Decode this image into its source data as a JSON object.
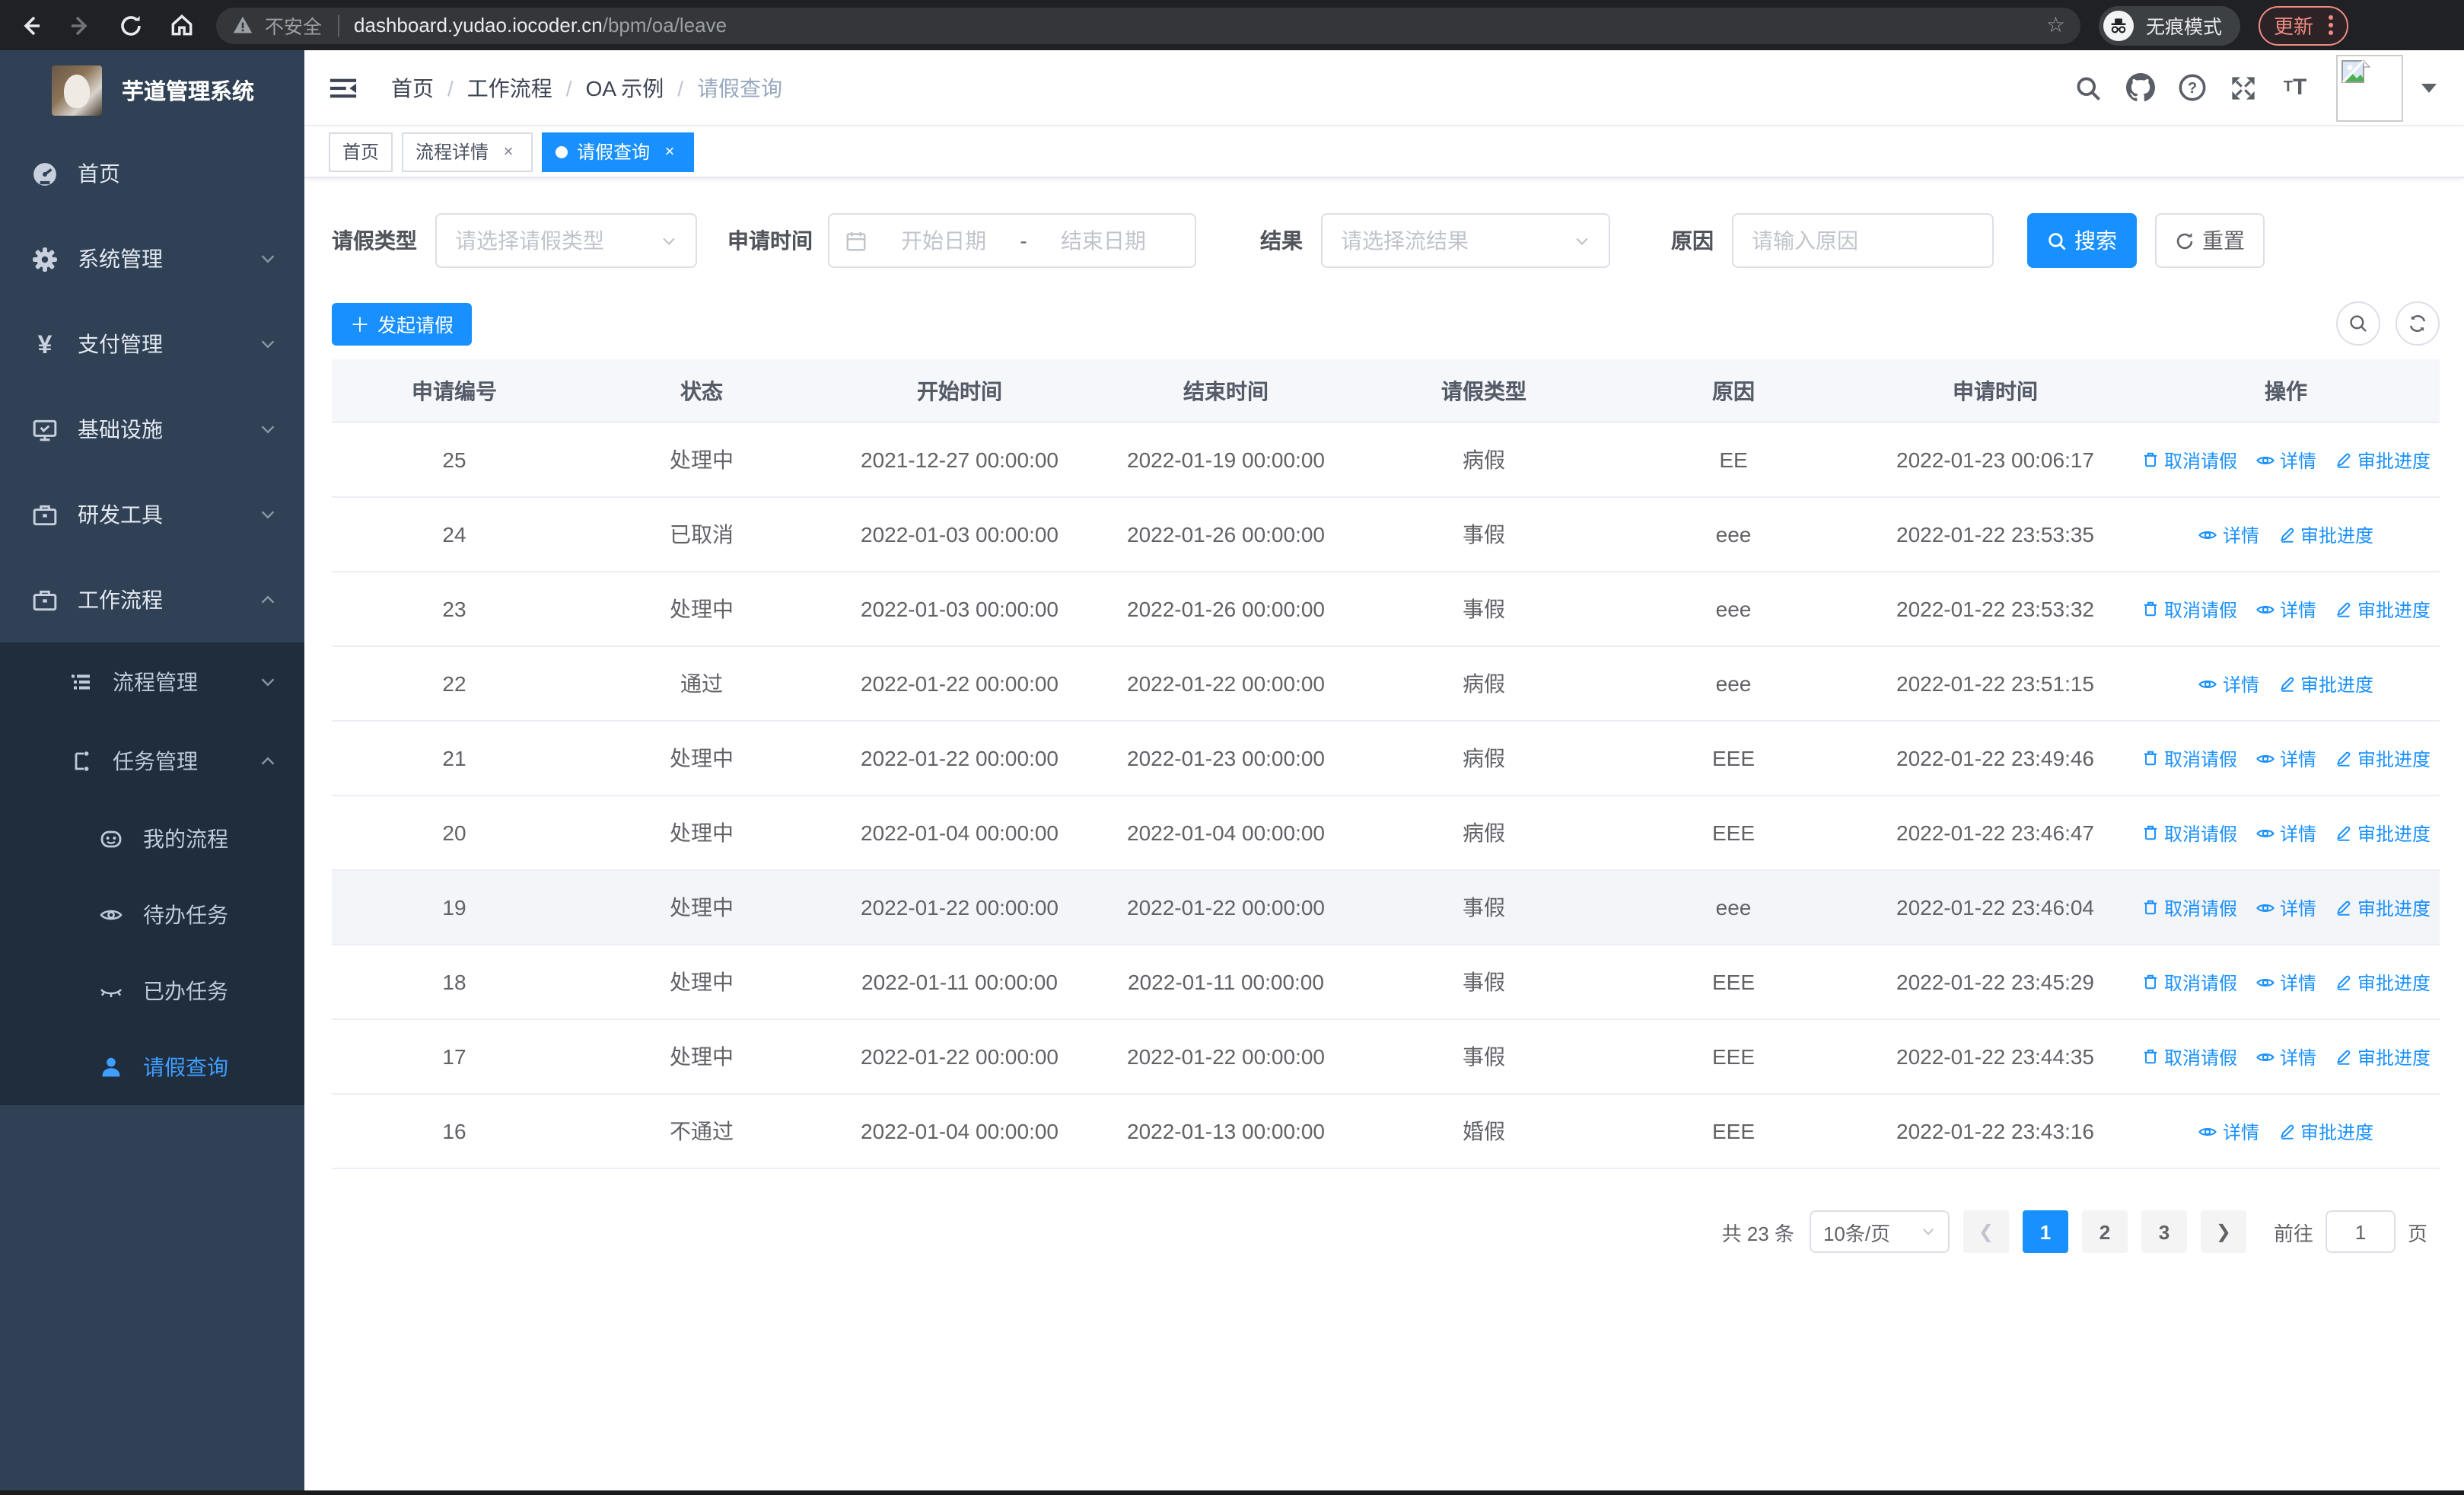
{
  "colors": {
    "accent": "#1890ff",
    "menu_active": "#409eff",
    "sidebar_bg": "#304156",
    "submenu_bg": "#1f2d3d"
  },
  "browser": {
    "security_label": "不安全",
    "url_host": "dashboard.yudao.iocoder.cn",
    "url_path": "/bpm/oa/leave",
    "incognito_label": "无痕模式",
    "update_label": "更新"
  },
  "sidebar": {
    "logo_title": "芋道管理系统",
    "items": [
      {
        "label": "首页"
      },
      {
        "label": "系统管理"
      },
      {
        "label": "支付管理"
      },
      {
        "label": "基础设施"
      },
      {
        "label": "研发工具"
      },
      {
        "label": "工作流程"
      }
    ],
    "workflow_children": [
      {
        "label": "流程管理"
      },
      {
        "label": "任务管理"
      }
    ],
    "task_children": [
      {
        "label": "我的流程"
      },
      {
        "label": "待办任务"
      },
      {
        "label": "已办任务"
      },
      {
        "label": "请假查询"
      }
    ]
  },
  "header": {
    "breadcrumb": [
      "首页",
      "工作流程",
      "OA 示例",
      "请假查询"
    ]
  },
  "tags": {
    "home": "首页",
    "detail": "流程详情",
    "current": "请假查询"
  },
  "filters": {
    "leave_type_label": "请假类型",
    "leave_type_placeholder": "请选择请假类型",
    "apply_time_label": "申请时间",
    "start_date_placeholder": "开始日期",
    "range_separator": "-",
    "end_date_placeholder": "结束日期",
    "result_label": "结果",
    "result_placeholder": "请选择流结果",
    "reason_label": "原因",
    "reason_placeholder": "请输入原因",
    "search_label": "搜索",
    "reset_label": "重置"
  },
  "toolbar": {
    "create_label": "发起请假"
  },
  "table": {
    "headers": [
      "申请编号",
      "状态",
      "开始时间",
      "结束时间",
      "请假类型",
      "原因",
      "申请时间",
      "操作"
    ],
    "action_labels": {
      "cancel": "取消请假",
      "detail": "详情",
      "progress": "审批进度"
    },
    "rows": [
      {
        "id": "25",
        "status": "处理中",
        "start": "2021-12-27 00:00:00",
        "end": "2022-01-19 00:00:00",
        "type": "病假",
        "reason": "EE",
        "applied": "2022-01-23 00:06:17",
        "cancelable": true,
        "highlight": false
      },
      {
        "id": "24",
        "status": "已取消",
        "start": "2022-01-03 00:00:00",
        "end": "2022-01-26 00:00:00",
        "type": "事假",
        "reason": "eee",
        "applied": "2022-01-22 23:53:35",
        "cancelable": false,
        "highlight": false
      },
      {
        "id": "23",
        "status": "处理中",
        "start": "2022-01-03 00:00:00",
        "end": "2022-01-26 00:00:00",
        "type": "事假",
        "reason": "eee",
        "applied": "2022-01-22 23:53:32",
        "cancelable": true,
        "highlight": false
      },
      {
        "id": "22",
        "status": "通过",
        "start": "2022-01-22 00:00:00",
        "end": "2022-01-22 00:00:00",
        "type": "病假",
        "reason": "eee",
        "applied": "2022-01-22 23:51:15",
        "cancelable": false,
        "highlight": false
      },
      {
        "id": "21",
        "status": "处理中",
        "start": "2022-01-22 00:00:00",
        "end": "2022-01-23 00:00:00",
        "type": "病假",
        "reason": "EEE",
        "applied": "2022-01-22 23:49:46",
        "cancelable": true,
        "highlight": false
      },
      {
        "id": "20",
        "status": "处理中",
        "start": "2022-01-04 00:00:00",
        "end": "2022-01-04 00:00:00",
        "type": "病假",
        "reason": "EEE",
        "applied": "2022-01-22 23:46:47",
        "cancelable": true,
        "highlight": false
      },
      {
        "id": "19",
        "status": "处理中",
        "start": "2022-01-22 00:00:00",
        "end": "2022-01-22 00:00:00",
        "type": "事假",
        "reason": "eee",
        "applied": "2022-01-22 23:46:04",
        "cancelable": true,
        "highlight": true
      },
      {
        "id": "18",
        "status": "处理中",
        "start": "2022-01-11 00:00:00",
        "end": "2022-01-11 00:00:00",
        "type": "事假",
        "reason": "EEE",
        "applied": "2022-01-22 23:45:29",
        "cancelable": true,
        "highlight": false
      },
      {
        "id": "17",
        "status": "处理中",
        "start": "2022-01-22 00:00:00",
        "end": "2022-01-22 00:00:00",
        "type": "事假",
        "reason": "EEE",
        "applied": "2022-01-22 23:44:35",
        "cancelable": true,
        "highlight": false
      },
      {
        "id": "16",
        "status": "不通过",
        "start": "2022-01-04 00:00:00",
        "end": "2022-01-13 00:00:00",
        "type": "婚假",
        "reason": "EEE",
        "applied": "2022-01-22 23:43:16",
        "cancelable": false,
        "highlight": false
      }
    ]
  },
  "pagination": {
    "total_label": "共 23 条",
    "page_size": "10条/页",
    "page1": "1",
    "page2": "2",
    "page3": "3",
    "goto_label": "前往",
    "goto_value": "1",
    "page_unit": "页"
  }
}
